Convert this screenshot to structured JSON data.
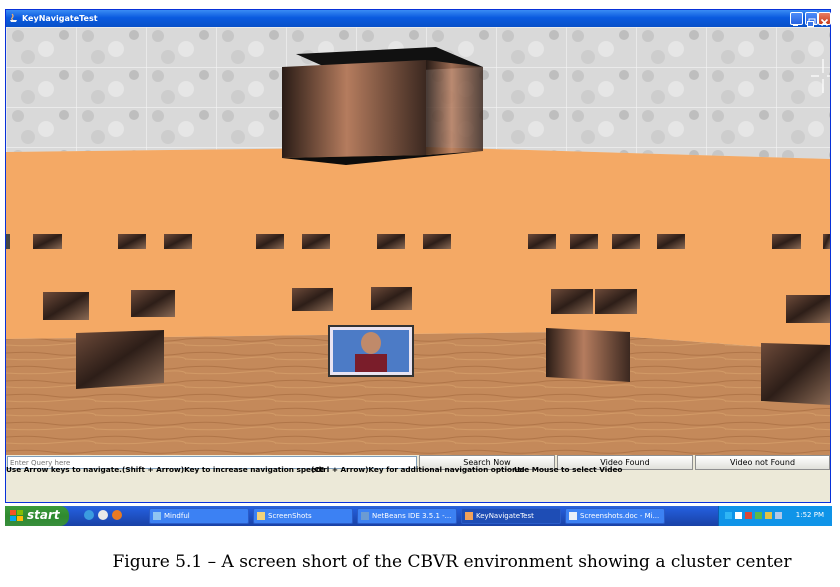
{
  "window": {
    "title": "KeyNavigateTest"
  },
  "search": {
    "placeholder": "Enter Query here",
    "value": ""
  },
  "buttons": {
    "search_now": "Search Now",
    "video_found": "Video Found",
    "video_not_found": "Video not Found"
  },
  "instructions": [
    "Use Arrow keys to navigate.",
    "(Shift + Arrow)Key to increase navigation speed!",
    "(Ctrl + Arrow)Key for additional navigation options!",
    "Use Mouse to select Video"
  ],
  "taskbar": {
    "start_label": "start",
    "items": [
      "Mindful",
      "ScreenShots",
      "NetBeans IDE 3.5.1 -...",
      "KeyNavigateTest",
      "Screenshots.doc - Mi..."
    ],
    "clock": "1:52 PM"
  },
  "caption": "Figure 5.1 – A screen short of the CBVR environment showing a cluster center",
  "colors": {
    "wall": "#F4A965",
    "floor": "#C58A55",
    "ceiling": "#D8D8D8",
    "titlebar": "#0A5ADF",
    "taskbar": "#245EDC",
    "start": "#3C9B3C"
  }
}
